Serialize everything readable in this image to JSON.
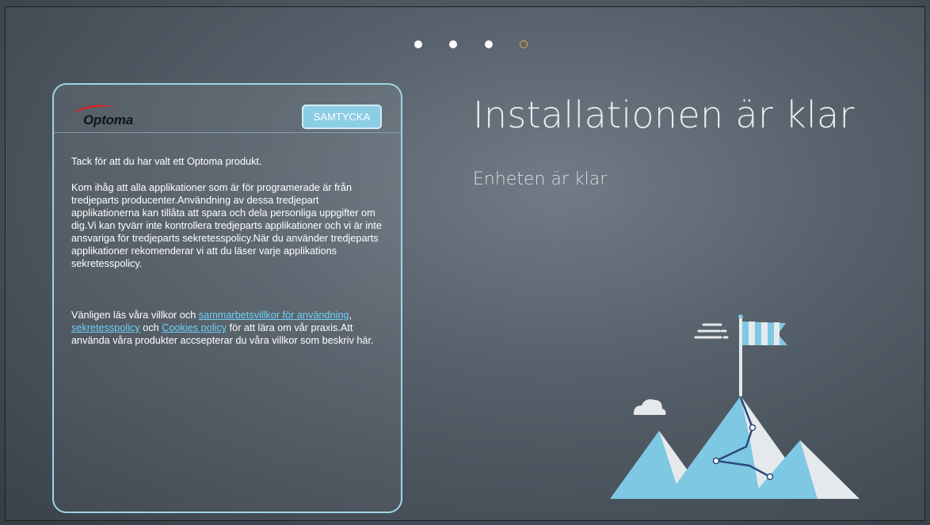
{
  "progress": {
    "total_steps": 4,
    "current_step": 4,
    "active_color": "#e0b030"
  },
  "card": {
    "brand": "Optoma",
    "agree_button": "SAMTYCKA",
    "p1": "Tack för att du har valt ett Optoma produkt.",
    "p2": "Kom ihåg att alla applikationer som är för programerade är från tredjeparts producenter.Användning av dessa tredjepart applikationerna kan tillåta att spara och dela personliga uppgifter om dig.Vi kan tyvärr inte kontrollera tredjeparts applikationer och vi är inte ansvariga för tredjeparts sekretesspolicy.När du använder tredjeparts applikationer rekomenderar vi att du läser varje applikations sekretesspolicy.",
    "p3_start": "Vänligen läs våra villkor och ",
    "link_terms": "sammarbetsvillkor för användning",
    "sep1": ", ",
    "link_privacy": "sekretesspolicy",
    "sep2": " och ",
    "link_cookies": "Cookies policy",
    "p3_end": " för att lära om vår praxis.Att använda våra produkter accsepterar du våra villkor som beskriv här."
  },
  "main": {
    "title": "Installationen är klar",
    "subtitle": "Enheten är klar"
  },
  "colors": {
    "accent": "#8ccde6",
    "link": "#6fd0f5",
    "mountain": "#7ec8e3",
    "snow": "#e6e9ec"
  },
  "icons": {
    "illustration": "mountain-flag-illustration"
  }
}
